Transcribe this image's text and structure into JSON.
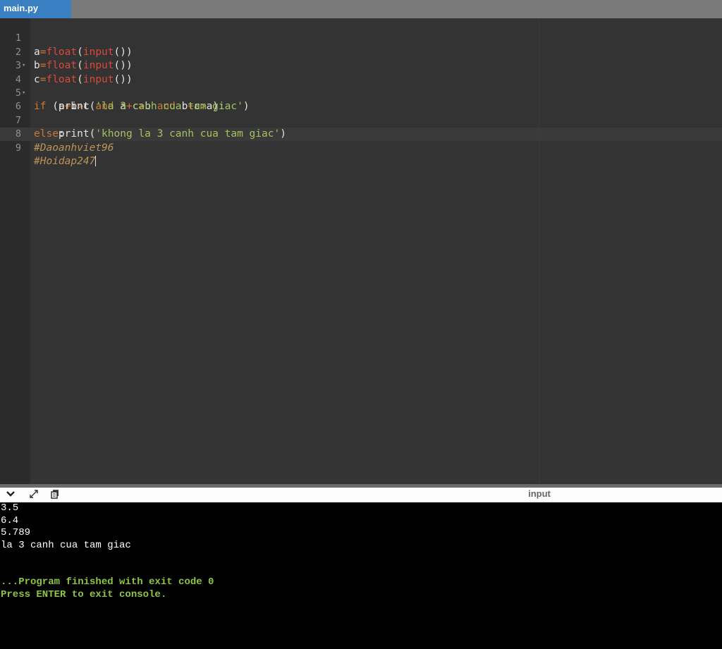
{
  "tabs": [
    {
      "label": "main.py",
      "active": true
    }
  ],
  "editor": {
    "lines": [
      {
        "n": "1",
        "fold": false
      },
      {
        "n": "2",
        "fold": false
      },
      {
        "n": "3",
        "fold": false
      },
      {
        "n": "4",
        "fold": true
      },
      {
        "n": "5",
        "fold": false
      },
      {
        "n": "6",
        "fold": true
      },
      {
        "n": "7",
        "fold": false
      },
      {
        "n": "8",
        "fold": false
      },
      {
        "n": "9",
        "fold": false
      }
    ],
    "tokens": {
      "l1": [
        "a",
        "=",
        "float",
        "(",
        "input",
        "())"
      ],
      "l2": [
        "b",
        "=",
        "float",
        "(",
        "input",
        "())"
      ],
      "l3": [
        "c",
        "=",
        "float",
        "(",
        "input",
        "())"
      ],
      "l4": [
        "if",
        " (",
        "a",
        "+",
        "b",
        ">",
        "c ",
        "and",
        " a",
        "+",
        "c",
        ">",
        "b ",
        "and",
        " b",
        "+",
        "c",
        ">",
        "a):"
      ],
      "l5": [
        "    print(",
        "'la 3 canh cua tam giac'",
        ")"
      ],
      "l6": [
        "else",
        ":"
      ],
      "l7": [
        "    print(",
        "'khong la 3 canh cua tam giac'",
        ")"
      ],
      "l8": [
        "#Daoanhviet96"
      ],
      "l9": [
        "#Hoidap247"
      ]
    }
  },
  "console_toolbar": {
    "collapse_icon": "chevron-down-icon",
    "expand_icon": "expand-icon",
    "copy_icon": "copy-icon",
    "input_label": "input"
  },
  "console": {
    "lines": [
      "3.5",
      "6.4",
      "5.789",
      "la 3 canh cua tam giac",
      "",
      "",
      "...Program finished with exit code 0",
      "Press ENTER to exit console."
    ]
  },
  "colors": {
    "keyword": "#cc7833",
    "function": "#da4939",
    "string": "#a5c261",
    "comment": "#bc9458",
    "tab_active": "#3a7fc1",
    "console_success": "#8ec63f"
  }
}
